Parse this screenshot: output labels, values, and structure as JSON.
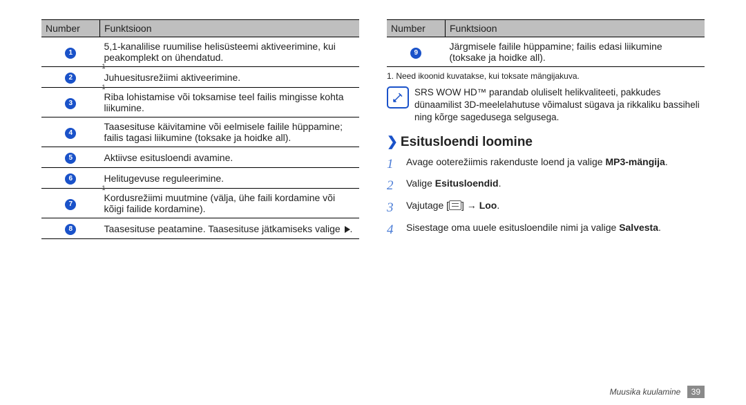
{
  "left": {
    "header_num": "Number",
    "header_func": "Funktsioon",
    "rows": [
      {
        "n": "1",
        "sup": "",
        "t": "5,1-kanalilise ruumilise helisüsteemi aktiveerimine, kui peakomplekt on ühendatud."
      },
      {
        "n": "2",
        "sup": "1",
        "t": "Juhuesitusrežiimi aktiveerimine."
      },
      {
        "n": "3",
        "sup": "1",
        "t": "Riba lohistamise või toksamise teel failis mingisse kohta liikumine."
      },
      {
        "n": "4",
        "sup": "",
        "t": "Taasesituse käivitamine või eelmisele failile hüppamine; failis tagasi liikumine (toksake ja hoidke all)."
      },
      {
        "n": "5",
        "sup": "",
        "t": "Aktiivse esitusloendi avamine."
      },
      {
        "n": "6",
        "sup": "",
        "t": "Helitugevuse reguleerimine."
      },
      {
        "n": "7",
        "sup": "1",
        "t": "Kordusrežiimi muutmine (välja, ühe faili kordamine või kõigi failide kordamine)."
      },
      {
        "n": "8",
        "sup": "",
        "t": "Taasesituse peatamine. Taasesituse jätkamiseks valige "
      }
    ],
    "play_suffix": "."
  },
  "right": {
    "header_num": "Number",
    "header_func": "Funktsioon",
    "row": {
      "n": "9",
      "t": "Järgmisele failile hüppamine; failis edasi liikumine (toksake ja hoidke all)."
    },
    "footnote": "1. Need ikoonid kuvatakse, kui toksate mängijakuva.",
    "info": "SRS WOW HD™ parandab oluliselt helikvaliteeti, pakkudes dünaamilist 3D-meelelahutuse võimalust sügava ja rikkaliku bassiheli ning kõrge sagedusega selgusega.",
    "heading": "Esitusloendi loomine",
    "steps": {
      "s1a": "Avage ooterežiimis rakenduste loend ja valige ",
      "s1b": "MP3-mängija",
      "s1c": ".",
      "s2a": "Valige ",
      "s2b": "Esitusloendid",
      "s2c": ".",
      "s3a": "Vajutage [",
      "s3b": "] → ",
      "s3c": "Loo",
      "s3d": ".",
      "s4a": "Sisestage oma uuele esitusloendile nimi ja valige ",
      "s4b": "Salvesta",
      "s4c": "."
    }
  },
  "footer": {
    "section": "Muusika kuulamine",
    "page": "39"
  }
}
